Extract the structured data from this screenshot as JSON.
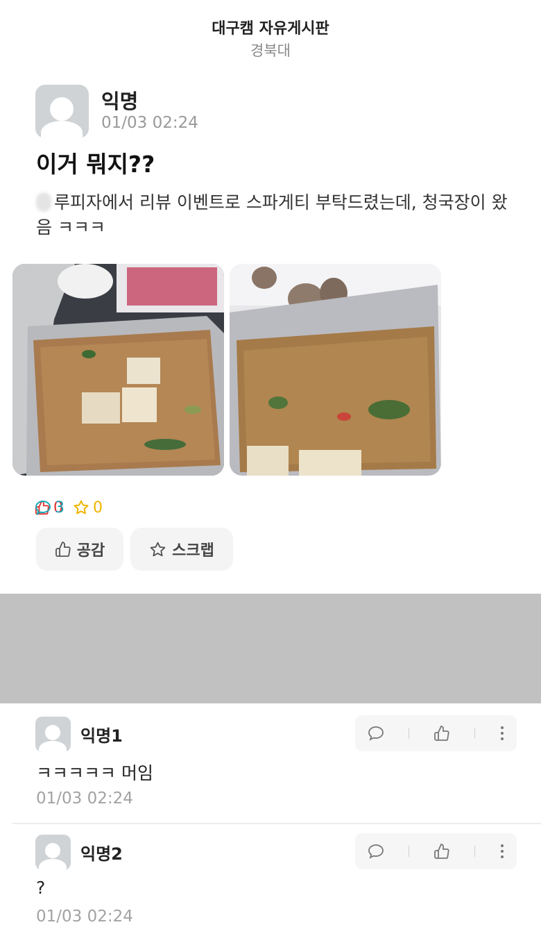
{
  "header": {
    "board_title": "대구캠 자유게시판",
    "school": "경북대"
  },
  "post": {
    "author": "익명",
    "time": "01/03 02:24",
    "title": "이거 뭐지??",
    "body": "루피자에서 리뷰 이벤트로 스파게티 부탁드렸는데, 청국장이 왔음 ㅋㅋㅋ",
    "images": [
      "food-photo-1",
      "food-photo-2"
    ],
    "stats": {
      "likes": "0",
      "comments": "3",
      "scraps": "0"
    },
    "actions": {
      "like_label": "공감",
      "scrap_label": "스크랩"
    }
  },
  "comments": [
    {
      "author": "익명1",
      "text": "ㅋㅋㅋㅋㅋ 머임",
      "time": "01/03 02:24"
    },
    {
      "author": "익명2",
      "text": "?",
      "time": "01/03 02:24"
    }
  ],
  "colors": {
    "like": "#e0302e",
    "comment": "#18a6b5",
    "scrap": "#f0b400",
    "ad_block": "#c1c1c1"
  }
}
